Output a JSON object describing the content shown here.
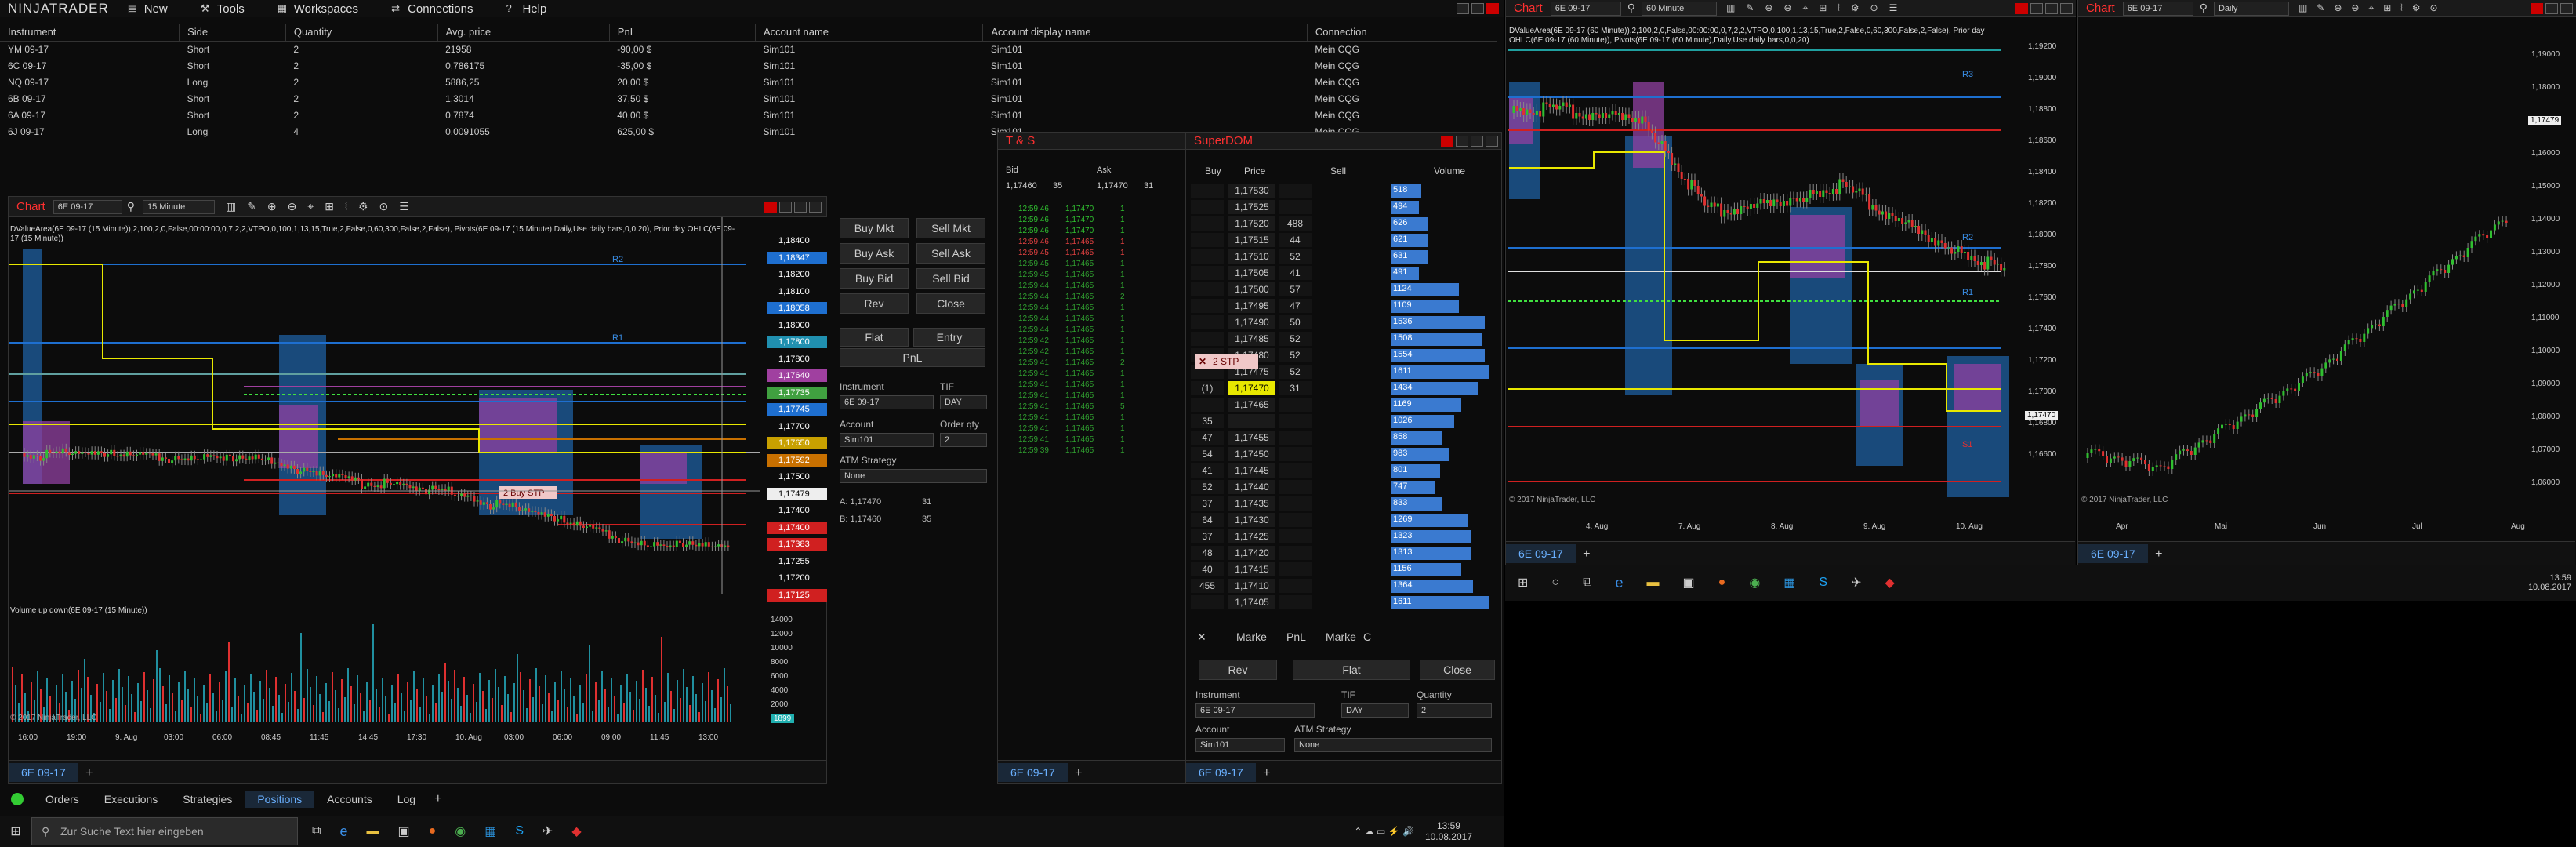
{
  "app": {
    "brand": "NINJATRADER",
    "menu": [
      {
        "label": "New",
        "icon": "new-icon"
      },
      {
        "label": "Tools",
        "icon": "tools-icon"
      },
      {
        "label": "Workspaces",
        "icon": "workspaces-icon"
      },
      {
        "label": "Connections",
        "icon": "connections-icon"
      },
      {
        "label": "Help",
        "icon": "help-icon"
      }
    ]
  },
  "positions": {
    "columns": [
      "Instrument",
      "Side",
      "Quantity",
      "Avg. price",
      "PnL",
      "Account name",
      "Account display name",
      "Connection"
    ],
    "rows": [
      {
        "instrument": "YM 09-17",
        "side": "Short",
        "qty": "2",
        "avg": "21958",
        "pnl": "-90,00 $",
        "pnl_sign": "neg",
        "account": "Sim101",
        "display": "Sim101",
        "conn": "Mein CQG"
      },
      {
        "instrument": "6C 09-17",
        "side": "Short",
        "qty": "2",
        "avg": "0,786175",
        "pnl": "-35,00 $",
        "pnl_sign": "neg",
        "account": "Sim101",
        "display": "Sim101",
        "conn": "Mein CQG"
      },
      {
        "instrument": "NQ 09-17",
        "side": "Long",
        "qty": "2",
        "avg": "5886,25",
        "pnl": "20,00 $",
        "pnl_sign": "pos",
        "account": "Sim101",
        "display": "Sim101",
        "conn": "Mein CQG"
      },
      {
        "instrument": "6B 09-17",
        "side": "Short",
        "qty": "2",
        "avg": "1,3014",
        "pnl": "37,50 $",
        "pnl_sign": "pos",
        "account": "Sim101",
        "display": "Sim101",
        "conn": "Mein CQG"
      },
      {
        "instrument": "6A 09-17",
        "side": "Short",
        "qty": "2",
        "avg": "0,7874",
        "pnl": "40,00 $",
        "pnl_sign": "pos",
        "account": "Sim101",
        "display": "Sim101",
        "conn": "Mein CQG"
      },
      {
        "instrument": "6J 09-17",
        "side": "Long",
        "qty": "4",
        "avg": "0,0091055",
        "pnl": "625,00 $",
        "pnl_sign": "pos",
        "account": "Sim101",
        "display": "Sim101",
        "conn": "Mein CQG"
      }
    ]
  },
  "bottom_tabs": [
    "Orders",
    "Executions",
    "Strategies",
    "Positions",
    "Accounts",
    "Log"
  ],
  "bottom_tabs_active": "Positions",
  "chart1": {
    "title": "Chart",
    "instrument": "6E 09-17",
    "interval": "15 Minute",
    "indicator_text": "DValueArea(6E 09-17 (15 Minute)),2,100,2,0,False,00:00:00,0,7,2,2,VTPO,0,100,1,13,15,True,2,False,0,60,300,False,2,False), Pivots(6E 09-17 (15 Minute),Daily,Use daily bars,0,0,20), Prior day OHLC(6E 09-17 (15 Minute))",
    "volume_title": "Volume up down(6E 09-17 (15 Minute))",
    "copyright": "© 2017 NinjaTrader, LLC",
    "tab": "6E 09-17",
    "xlabels": [
      "16:00",
      "19:00",
      "9. Aug",
      "03:00",
      "06:00",
      "08:45",
      "11:45",
      "14:45",
      "17:30",
      "10. Aug",
      "03:00",
      "06:00",
      "09:00",
      "11:45",
      "13:00"
    ],
    "price_labels": [
      {
        "v": "1,18400",
        "c": "#0c0c0c",
        "y": 0
      },
      {
        "v": "1,18347",
        "c": "#1e6fd0",
        "y": 1
      },
      {
        "v": "1,18200",
        "c": "#0c0c0c",
        "y": 2
      },
      {
        "v": "1,18100",
        "c": "#0c0c0c",
        "y": 3
      },
      {
        "v": "1,18058",
        "c": "#1e6fd0",
        "y": 4
      },
      {
        "v": "1,18000",
        "c": "#0c0c0c",
        "y": 5
      },
      {
        "v": "1,17800",
        "c": "#2090b0",
        "y": 6
      },
      {
        "v": "1,17800",
        "c": "#0c0c0c",
        "y": 7
      },
      {
        "v": "1,17640",
        "c": "#a040a0",
        "y": 8
      },
      {
        "v": "1,17735",
        "c": "#40a040",
        "y": 9
      },
      {
        "v": "1,17745",
        "c": "#1e6fd0",
        "y": 10
      },
      {
        "v": "1,17700",
        "c": "#0c0c0c",
        "y": 11
      },
      {
        "v": "1,17650",
        "c": "#c8a000",
        "y": 12
      },
      {
        "v": "1,17592",
        "c": "#c87000",
        "y": 13
      },
      {
        "v": "1,17500",
        "c": "#0c0c0c",
        "y": 14
      },
      {
        "v": "1,17479",
        "c": "#eeeeee",
        "y": 15
      },
      {
        "v": "1,17400",
        "c": "#0c0c0c",
        "y": 16
      },
      {
        "v": "1,17400",
        "c": "#d02020",
        "y": 17
      },
      {
        "v": "1,17383",
        "c": "#d02020",
        "y": 18
      },
      {
        "v": "1,17255",
        "c": "#0c0c0c",
        "y": 19
      },
      {
        "v": "1,17200",
        "c": "#0c0c0c",
        "y": 20
      },
      {
        "v": "1,17125",
        "c": "#d02020",
        "y": 21
      }
    ],
    "vol_labels": [
      "14000",
      "12000",
      "10000",
      "8000",
      "6000",
      "4000",
      "2000",
      "1899"
    ],
    "pivot_labels": [
      "R2",
      "R1"
    ],
    "order_marker": "2 Buy STP"
  },
  "chart_trader": {
    "buttons": [
      [
        "Buy Mkt",
        "Sell Mkt"
      ],
      [
        "Buy Ask",
        "Sell Ask"
      ],
      [
        "Buy Bid",
        "Sell Bid"
      ],
      [
        "Rev",
        "Close"
      ]
    ],
    "flat": "Flat",
    "entry": "Entry",
    "pnl": "PnL",
    "instrument_label": "Instrument",
    "instrument": "6E 09-17",
    "tif_label": "TIF",
    "tif": "DAY",
    "account_label": "Account",
    "account": "Sim101",
    "qty_label": "Order qty",
    "qty": "2",
    "atm_label": "ATM Strategy",
    "atm": "None",
    "ask": "A: 1,17470",
    "ask_sz": "31",
    "bid": "B: 1,17460",
    "bid_sz": "35"
  },
  "ts": {
    "title": "T & S",
    "bid_h": "Bid",
    "ask_h": "Ask",
    "bid": "1,17460",
    "bid_sz": "35",
    "ask": "1,17470",
    "ask_sz": "31",
    "rows": [
      {
        "t": "12:59:46",
        "p": "1,17470",
        "s": "1",
        "c": "#30c030"
      },
      {
        "t": "12:59:46",
        "p": "1,17470",
        "s": "1",
        "c": "#30c030"
      },
      {
        "t": "12:59:46",
        "p": "1,17470",
        "s": "1",
        "c": "#30c030"
      },
      {
        "t": "12:59:46",
        "p": "1,17465",
        "s": "1",
        "c": "#e04040"
      },
      {
        "t": "12:59:45",
        "p": "1,17465",
        "s": "1",
        "c": "#e04040"
      },
      {
        "t": "12:59:45",
        "p": "1,17465",
        "s": "1",
        "c": "#30a030"
      },
      {
        "t": "12:59:45",
        "p": "1,17465",
        "s": "1",
        "c": "#30a030"
      },
      {
        "t": "12:59:44",
        "p": "1,17465",
        "s": "1",
        "c": "#30a030"
      },
      {
        "t": "12:59:44",
        "p": "1,17465",
        "s": "2",
        "c": "#30a030"
      },
      {
        "t": "12:59:44",
        "p": "1,17465",
        "s": "1",
        "c": "#30a030"
      },
      {
        "t": "12:59:44",
        "p": "1,17465",
        "s": "1",
        "c": "#30a030"
      },
      {
        "t": "12:59:44",
        "p": "1,17465",
        "s": "1",
        "c": "#30a030"
      },
      {
        "t": "12:59:42",
        "p": "1,17465",
        "s": "1",
        "c": "#30a030"
      },
      {
        "t": "12:59:42",
        "p": "1,17465",
        "s": "1",
        "c": "#30a030"
      },
      {
        "t": "12:59:41",
        "p": "1,17465",
        "s": "2",
        "c": "#30a030"
      },
      {
        "t": "12:59:41",
        "p": "1,17465",
        "s": "1",
        "c": "#30a030"
      },
      {
        "t": "12:59:41",
        "p": "1,17465",
        "s": "1",
        "c": "#30a030"
      },
      {
        "t": "12:59:41",
        "p": "1,17465",
        "s": "1",
        "c": "#30a030"
      },
      {
        "t": "12:59:41",
        "p": "1,17465",
        "s": "5",
        "c": "#30a030"
      },
      {
        "t": "12:59:41",
        "p": "1,17465",
        "s": "1",
        "c": "#30a030"
      },
      {
        "t": "12:59:41",
        "p": "1,17465",
        "s": "1",
        "c": "#30a030"
      },
      {
        "t": "12:59:41",
        "p": "1,17465",
        "s": "1",
        "c": "#30a030"
      },
      {
        "t": "12:59:39",
        "p": "1,17465",
        "s": "1",
        "c": "#30a030"
      }
    ],
    "tab": "6E 09-17"
  },
  "dom": {
    "title": "SuperDOM",
    "h_buy": "Buy",
    "h_price": "Price",
    "h_sell": "Sell",
    "h_vol": "Volume",
    "rows": [
      {
        "buy": "",
        "price": "1,17530",
        "sell": "",
        "vol": "518",
        "w": 0.13
      },
      {
        "buy": "",
        "price": "1,17525",
        "sell": "",
        "vol": "494",
        "w": 0.12
      },
      {
        "buy": "",
        "price": "1,17520",
        "sell": "488",
        "vol": "626",
        "w": 0.16
      },
      {
        "buy": "",
        "price": "1,17515",
        "sell": "44",
        "vol": "621",
        "w": 0.16
      },
      {
        "buy": "",
        "price": "1,17510",
        "sell": "52",
        "vol": "631",
        "w": 0.16
      },
      {
        "buy": "",
        "price": "1,17505",
        "sell": "41",
        "vol": "491",
        "w": 0.12
      },
      {
        "buy": "",
        "price": "1,17500",
        "sell": "57",
        "vol": "1124",
        "w": 0.29
      },
      {
        "buy": "",
        "price": "1,17495",
        "sell": "47",
        "vol": "1109",
        "w": 0.29
      },
      {
        "buy": "",
        "price": "1,17490",
        "sell": "50",
        "vol": "1536",
        "w": 0.4
      },
      {
        "buy": "",
        "price": "1,17485",
        "sell": "52",
        "vol": "1508",
        "w": 0.39
      },
      {
        "buy": "",
        "price": "1,17480",
        "sell": "52",
        "vol": "1554",
        "w": 0.4
      },
      {
        "buy": "",
        "price": "1,17475",
        "sell": "52",
        "vol": "1611",
        "w": 0.42
      },
      {
        "buy": "(1)",
        "price": "1,17470",
        "sell": "31",
        "vol": "1434",
        "w": 0.37,
        "hl": true
      },
      {
        "buy": "",
        "price": "1,17465",
        "sell": "",
        "vol": "1169",
        "w": 0.3
      },
      {
        "buy": "35",
        "price": "",
        "sell": "",
        "vol": "1026",
        "w": 0.27
      },
      {
        "buy": "47",
        "price": "1,17455",
        "sell": "",
        "vol": "858",
        "w": 0.22
      },
      {
        "buy": "54",
        "price": "1,17450",
        "sell": "",
        "vol": "983",
        "w": 0.25
      },
      {
        "buy": "41",
        "price": "1,17445",
        "sell": "",
        "vol": "801",
        "w": 0.21
      },
      {
        "buy": "52",
        "price": "1,17440",
        "sell": "",
        "vol": "747",
        "w": 0.19
      },
      {
        "buy": "37",
        "price": "1,17435",
        "sell": "",
        "vol": "833",
        "w": 0.22
      },
      {
        "buy": "64",
        "price": "1,17430",
        "sell": "",
        "vol": "1269",
        "w": 0.33
      },
      {
        "buy": "37",
        "price": "1,17425",
        "sell": "",
        "vol": "1323",
        "w": 0.34
      },
      {
        "buy": "48",
        "price": "1,17420",
        "sell": "",
        "vol": "1313",
        "w": 0.34
      },
      {
        "buy": "40",
        "price": "1,17415",
        "sell": "",
        "vol": "1156",
        "w": 0.3
      },
      {
        "buy": "455",
        "price": "1,17410",
        "sell": "",
        "vol": "1364",
        "w": 0.35
      },
      {
        "buy": "",
        "price": "1,17405",
        "sell": "",
        "vol": "1611",
        "w": 0.42
      }
    ],
    "stp": "2 STP",
    "bottom": [
      "Marke",
      "PnL",
      "Marke",
      "C"
    ],
    "rev": "Rev",
    "flat": "Flat",
    "close": "Close",
    "instrument_label": "Instrument",
    "instrument": "6E 09-17",
    "tif_label": "TIF",
    "tif": "DAY",
    "qty_label": "Quantity",
    "qty": "2",
    "account_label": "Account",
    "account": "Sim101",
    "atm_label": "ATM Strategy",
    "atm": "None",
    "tab": "6E 09-17"
  },
  "chart2": {
    "title": "Chart",
    "instrument": "6E 09-17",
    "interval": "60 Minute",
    "indicator_text": "DValueArea(6E 09-17 (60 Minute)),2,100,2,0,False,00:00:00,0,7,2,2,VTPO,0,100,1,13,15,True,2,False,0,60,300,False,2,False), Prior day OHLC(6E 09-17 (60 Minute)), Pivots(6E 09-17 (60 Minute),Daily,Use daily bars,0,0,20)",
    "copyright": "© 2017 NinjaTrader, LLC",
    "tab": "6E 09-17",
    "xlabels": [
      "4. Aug",
      "7. Aug",
      "8. Aug",
      "9. Aug",
      "10. Aug"
    ],
    "ylabels": [
      "1,19200",
      "1,19000",
      "1,18800",
      "1,18600",
      "1,18400",
      "1,18200",
      "1,18000",
      "1,17800",
      "1,17600",
      "1,17400",
      "1,17200",
      "1,17000",
      "1,16800",
      "1,16600"
    ],
    "last": "1,17470",
    "pivots": [
      "R3",
      "R2",
      "R1",
      "S1"
    ]
  },
  "chart3": {
    "title": "Chart",
    "instrument": "6E 09-17",
    "interval": "Daily",
    "copyright": "© 2017 NinjaTrader, LLC",
    "tab": "6E 09-17",
    "xlabels": [
      "Apr",
      "Mai",
      "Jun",
      "Jul",
      "Aug"
    ],
    "ylabels": [
      "1,19000",
      "1,18000",
      "1,17000",
      "1,16000",
      "1,15000",
      "1,14000",
      "1,13000",
      "1,12000",
      "1,11000",
      "1,10000",
      "1,09000",
      "1,08000",
      "1,07000",
      "1,06000"
    ],
    "last": "1,17479"
  },
  "taskbar": {
    "search_placeholder": "Zur Suche Text hier eingeben",
    "time": "13:59",
    "date": "10.08.2017"
  }
}
